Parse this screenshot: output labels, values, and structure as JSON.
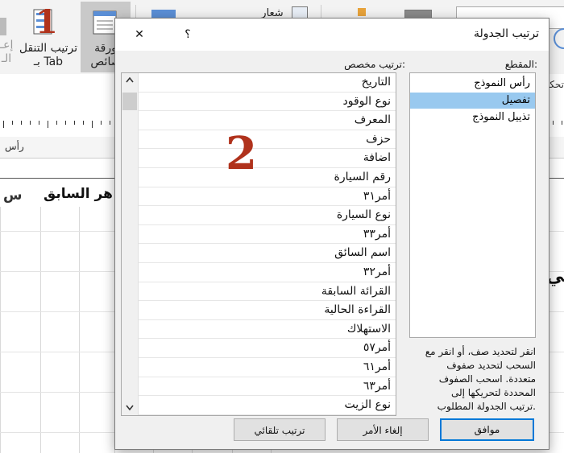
{
  "ribbon": {
    "tab_order_label": "ترتيب التنقل\nبـ Tab",
    "tab_order_line1": "ترتيب التنقل",
    "tab_order_line2": "بـ Tab",
    "property_sheet_line1": "ورقة",
    "property_sheet_line2": "صائص",
    "logo_label": "شعار",
    "partial_left_label": "إعـ",
    "partial_left_label2": "الـ"
  },
  "subbar": {
    "partial_label": "تحكم"
  },
  "section_bar": {
    "label": "رأس"
  },
  "report": {
    "prev_month_text": "هر السابق",
    "left_partial": "س",
    "right_partial": "مي"
  },
  "annotations": {
    "one": "1",
    "two": "2"
  },
  "dialog": {
    "title": "ترتيب الجدولة",
    "help_button": "؟",
    "close_button": "✕",
    "section_label": "المقطع:",
    "custom_order_label": "ترتيب مخصص:",
    "sections": [
      {
        "label": "رأس النموذج",
        "selected": false
      },
      {
        "label": "تفصيل",
        "selected": true
      },
      {
        "label": "تذييل النموذج",
        "selected": false
      }
    ],
    "fields": [
      "التاريخ",
      "نوع الوقود",
      "المعرف",
      "حزف",
      "اضافة",
      "رقم السيارة",
      "أمر٣١",
      "نوع السيارة",
      "أمر٣٣",
      "اسم السائق",
      "أمر٣٢",
      "القرائة السابقة",
      "القراءة الحالية",
      "الاستهلاك",
      "أمر٥٧",
      "أمر٦١",
      "أمر٦٣",
      "نوع الزيت"
    ],
    "help_text": [
      "انقر لتحديد صف، أو انقر مع",
      "السحب لتحديد صفوف",
      "متعددة. اسحب الصفوف",
      "المحددة لتحريكها إلى",
      "ترتيب الجدولة المطلوب."
    ],
    "buttons": {
      "ok": "موافق",
      "cancel": "إلغاء الأمر",
      "auto_order": "ترتيب تلقائي"
    },
    "colors": {
      "selection": "#99c9ef",
      "accent": "#0078d7"
    }
  }
}
